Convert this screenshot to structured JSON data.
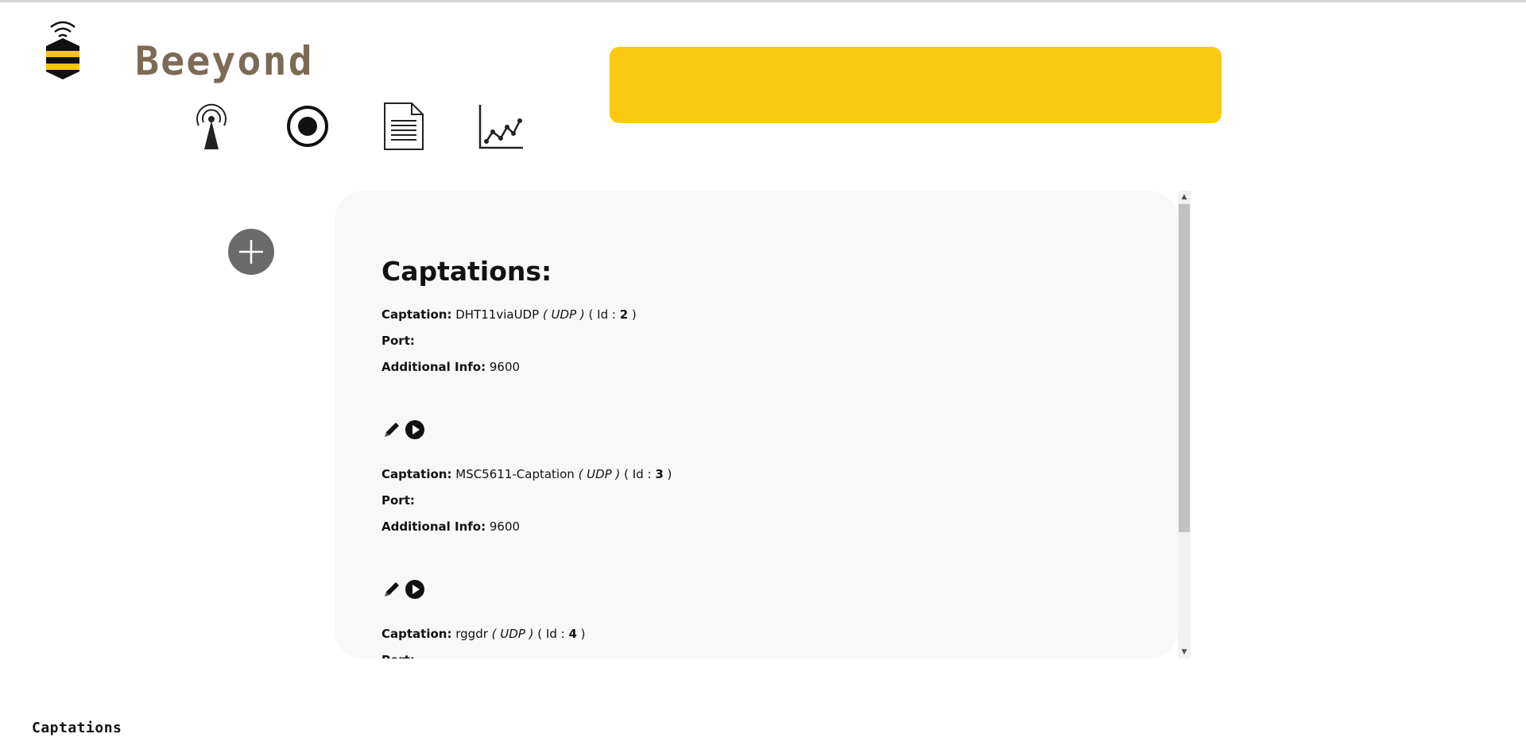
{
  "brand": {
    "name": "Beeyond",
    "logo_icon": "bee-wifi-logo"
  },
  "nav": {
    "icons": [
      "antenna-icon",
      "record-icon",
      "document-icon",
      "chart-icon"
    ]
  },
  "colors": {
    "banner": "#fbc912",
    "brand_text": "#7a6b57",
    "add_button": "#6b6b6b",
    "panel_bg": "#f8f8f8"
  },
  "add_button": {
    "icon": "plus-icon"
  },
  "panel": {
    "title": "Captations:",
    "labels": {
      "captation": "Captation:",
      "port": "Port:",
      "info": "Additional Info:",
      "id_open": "( Id : ",
      "id_close": " )"
    },
    "captations": [
      {
        "name": "DHT11viaUDP",
        "protocol": "( UDP )",
        "id": "2",
        "port": "",
        "info": "9600"
      },
      {
        "name": "MSC5611-Captation",
        "protocol": "( UDP )",
        "id": "3",
        "port": "",
        "info": "9600"
      },
      {
        "name": "rggdr",
        "protocol": "( UDP )",
        "id": "4",
        "port": "",
        "info": ""
      }
    ]
  },
  "footer": {
    "label": "Captations"
  }
}
